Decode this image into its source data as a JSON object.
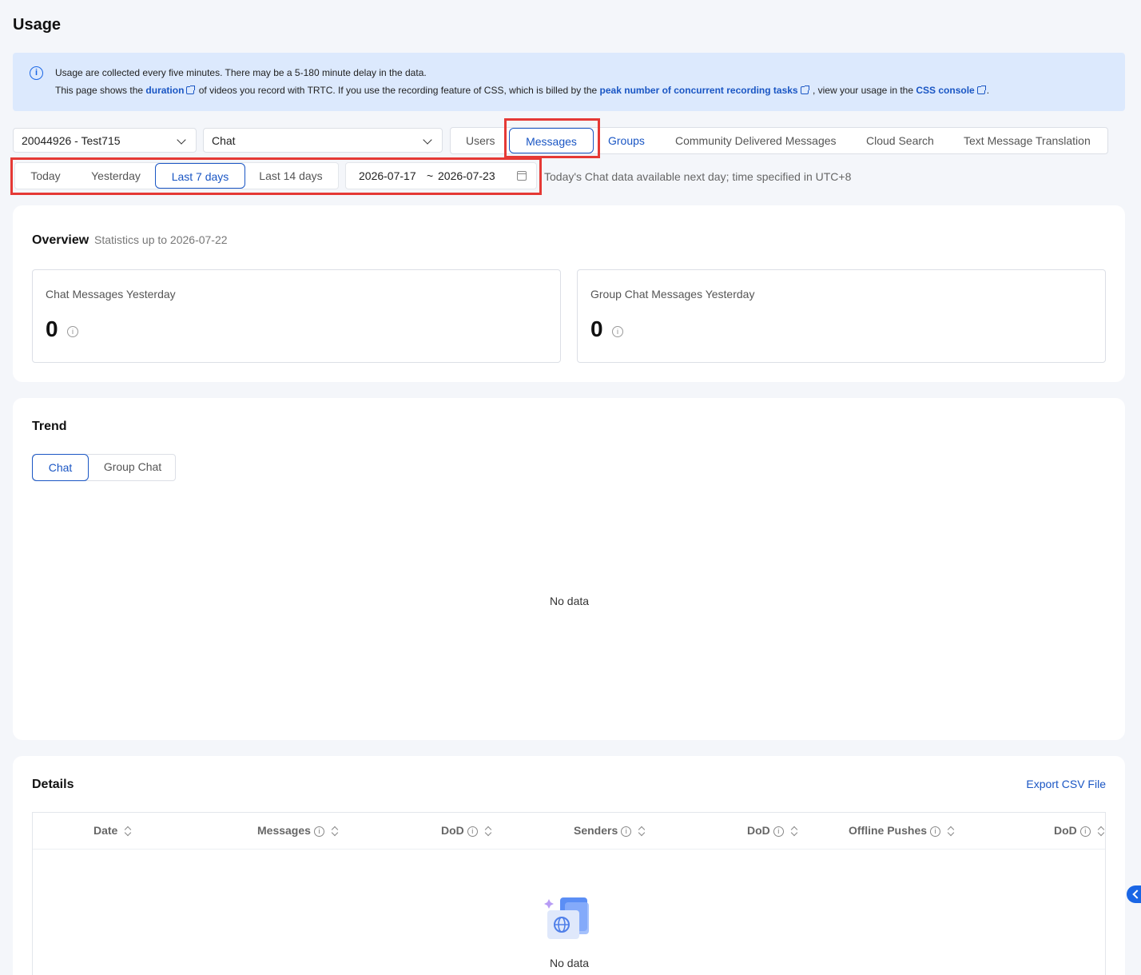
{
  "page": {
    "title": "Usage"
  },
  "notice": {
    "line1": "Usage are collected every five minutes. There may be a 5-180 minute delay in the data.",
    "line2_a": "This page shows the ",
    "link_duration": "duration",
    "line2_b": " of videos you record with TRTC. If you use the recording feature of CSS, which is billed by the ",
    "link_peak": "peak number of concurrent recording tasks",
    "line2_c": " , view your usage in the ",
    "link_console": "CSS console",
    "line2_d": "."
  },
  "app_select": {
    "value": "20044926 - Test715"
  },
  "product_select": {
    "value": "Chat"
  },
  "tabs": [
    {
      "label": "Users"
    },
    {
      "label": "Messages"
    },
    {
      "label": "Groups"
    },
    {
      "label": "Community Delivered Messages"
    },
    {
      "label": "Cloud Search"
    },
    {
      "label": "Text Message Translation"
    }
  ],
  "range_tabs": [
    {
      "label": "Today"
    },
    {
      "label": "Yesterday"
    },
    {
      "label": "Last 7 days"
    },
    {
      "label": "Last 14 days"
    }
  ],
  "date_range": {
    "start": "2026-07-17",
    "sep": "~",
    "end": "2026-07-23"
  },
  "hint": "Today's Chat data available next day; time specified in UTC+8",
  "overview": {
    "title": "Overview",
    "subtitle": "Statistics up to 2026-07-22",
    "stats": [
      {
        "label": "Chat Messages Yesterday",
        "value": "0"
      },
      {
        "label": "Group Chat Messages Yesterday",
        "value": "0"
      }
    ]
  },
  "trend": {
    "title": "Trend",
    "tabs": [
      {
        "label": "Chat"
      },
      {
        "label": "Group Chat"
      }
    ],
    "empty": "No data"
  },
  "details": {
    "title": "Details",
    "export": "Export CSV File",
    "columns": [
      {
        "label": "Date"
      },
      {
        "label": "Messages"
      },
      {
        "label": "DoD"
      },
      {
        "label": "Senders"
      },
      {
        "label": "DoD"
      },
      {
        "label": "Offline Pushes"
      },
      {
        "label": "DoD"
      }
    ],
    "empty": "No data"
  },
  "colors": {
    "accent": "#1a56c4",
    "highlight": "#e53935",
    "notice_bg": "#dce9fd"
  },
  "icons": {
    "info": "info-circle-icon",
    "external": "external-link-icon",
    "calendar": "calendar-icon",
    "sort": "sort-icon",
    "empty": "empty-globe-document-icon",
    "collapse": "chevron-left-icon"
  }
}
